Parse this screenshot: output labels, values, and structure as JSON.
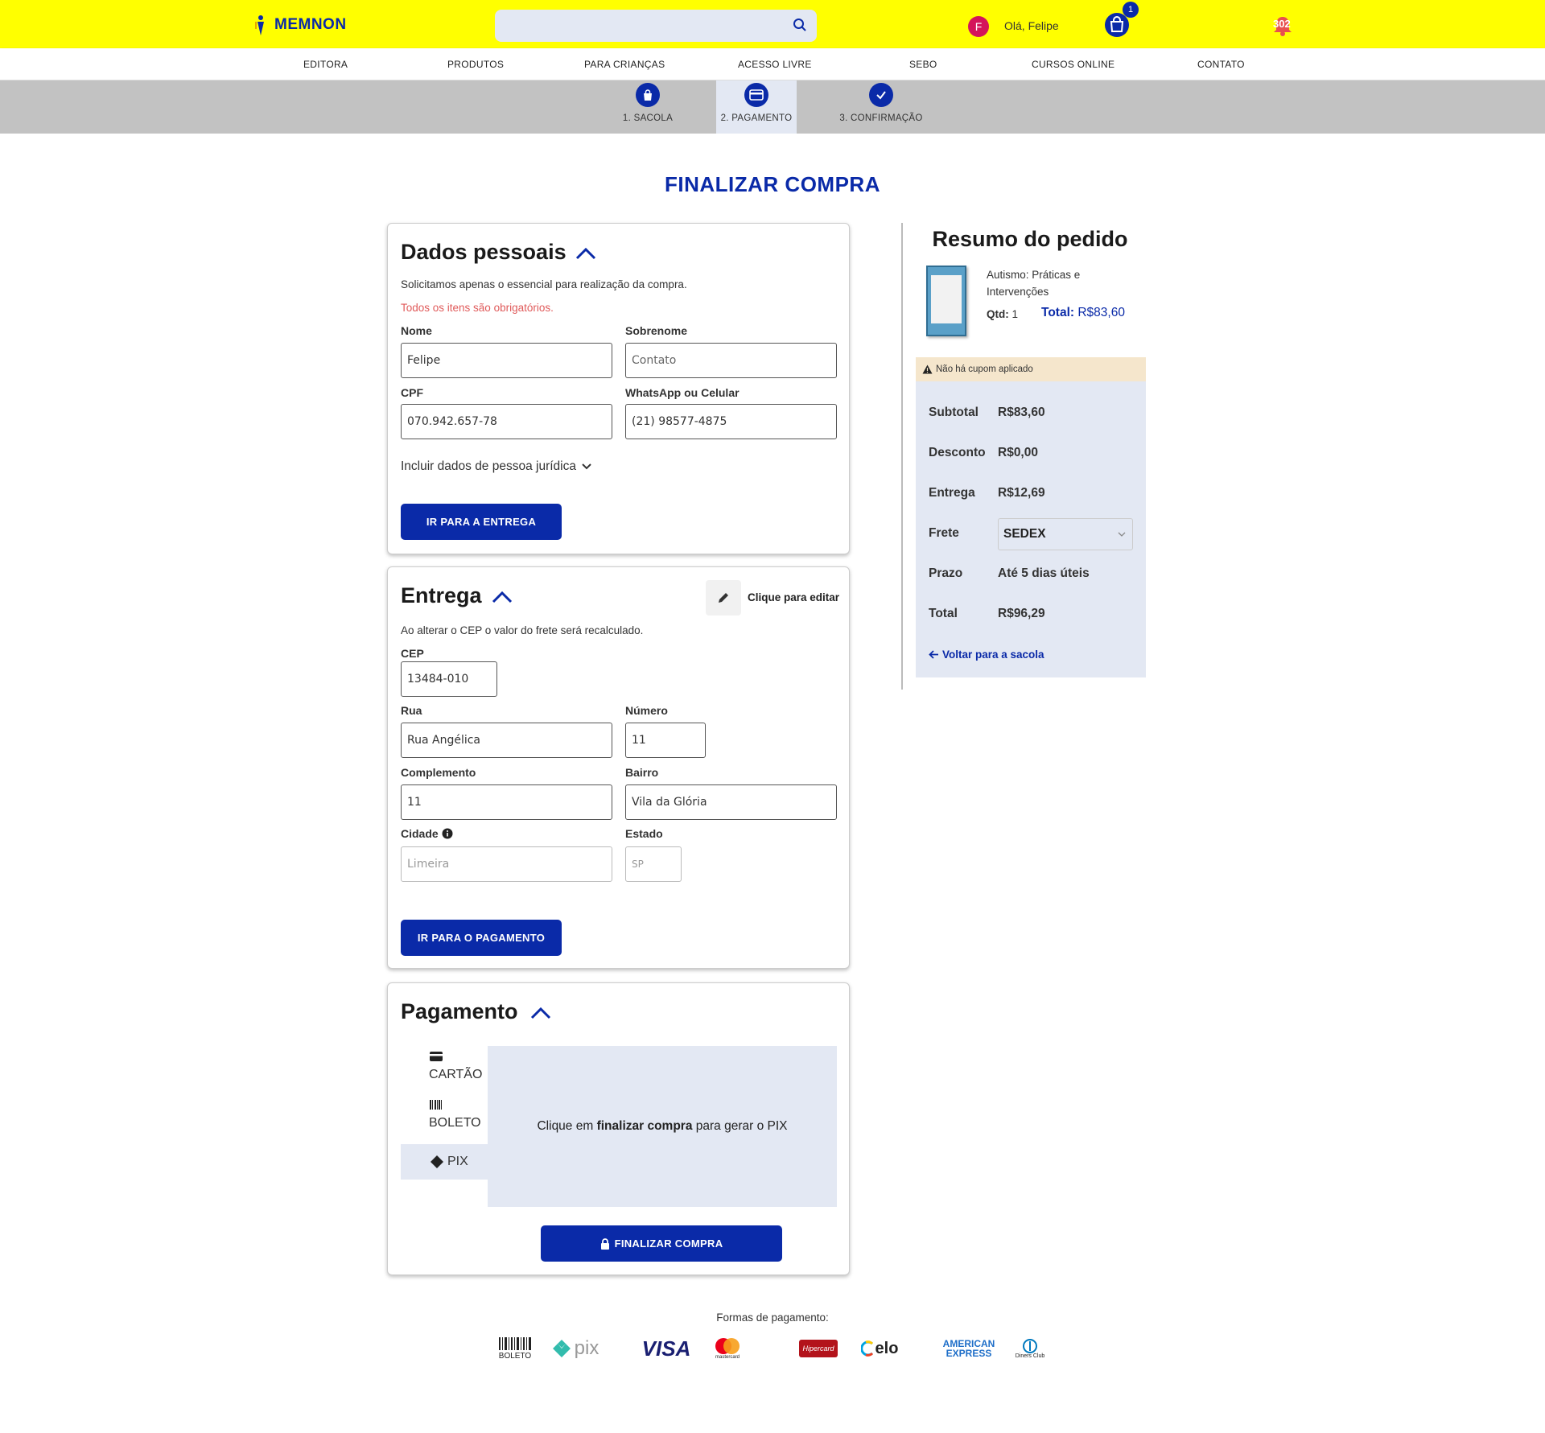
{
  "header": {
    "brand": "MEMNON",
    "search_placeholder": "",
    "user_initial": "F",
    "greeting": "Olá, Felipe",
    "cart_count": "1",
    "notification_count": "302"
  },
  "nav": {
    "items": [
      "EDITORA",
      "PRODUTOS",
      "PARA CRIANÇAS",
      "ACESSO LIVRE",
      "SEBO",
      "CURSOS ONLINE",
      "CONTATO"
    ]
  },
  "steps": [
    {
      "label": "1. SACOLA",
      "icon": "bag-icon"
    },
    {
      "label": "2. PAGAMENTO",
      "icon": "credit-card-icon"
    },
    {
      "label": "3. CONFIRMAÇÃO",
      "icon": "check-icon"
    }
  ],
  "page_title": "FINALIZAR COMPRA",
  "personal": {
    "title": "Dados pessoais",
    "subtitle": "Solicitamos apenas o essencial para realização da compra.",
    "required_note": "Todos os itens são obrigatórios.",
    "nome_label": "Nome",
    "nome_value": "Felipe",
    "sobrenome_label": "Sobrenome",
    "sobrenome_placeholder": "Contato",
    "cpf_label": "CPF",
    "cpf_value": "070.942.657-78",
    "phone_label": "WhatsApp ou Celular",
    "phone_value": "(21) 98577-4875",
    "pj_toggle": "Incluir dados de pessoa jurídica",
    "button": "IR PARA A ENTREGA"
  },
  "delivery": {
    "title": "Entrega",
    "edit_label": "Clique para editar",
    "note": "Ao alterar o CEP o valor do frete será recalculado.",
    "cep_label": "CEP",
    "cep_value": "13484-010",
    "rua_label": "Rua",
    "rua_value": "Rua Angélica",
    "numero_label": "Número",
    "numero_value": "11",
    "complemento_label": "Complemento",
    "complemento_value": "11",
    "bairro_label": "Bairro",
    "bairro_value": "Vila da Glória",
    "cidade_label": "Cidade",
    "cidade_placeholder": "Limeira",
    "estado_label": "Estado",
    "estado_placeholder": "SP",
    "button": "IR PARA O PAGAMENTO"
  },
  "payment": {
    "title": "Pagamento",
    "tabs": [
      "CARTÃO",
      "BOLETO",
      "PIX"
    ],
    "selected_tab": "PIX",
    "panel_prefix": "Clique em ",
    "panel_bold": "finalizar compra",
    "panel_suffix": " para gerar o PIX",
    "button": "FINALIZAR COMPRA"
  },
  "summary": {
    "title": "Resumo do pedido",
    "product_name": "Autismo: Práticas e Intervenções",
    "qty_label": "Qtd:",
    "qty_value": "1",
    "total_label": "Total:",
    "total_value": "R$83,60",
    "coupon_note": "Não há cupom aplicado",
    "subtotal_label": "Subtotal",
    "subtotal_value": "R$83,60",
    "discount_label": "Desconto",
    "discount_value": "R$0,00",
    "delivery_label": "Entrega",
    "delivery_value": "R$12,69",
    "shipping_label": "Frete",
    "shipping_value": "SEDEX",
    "deadline_label": "Prazo",
    "deadline_value": "Até 5 dias úteis",
    "grand_total_label": "Total",
    "grand_total_value": "R$96,29",
    "back_link": "Voltar para a sacola"
  },
  "footer": {
    "payment_methods_label": "Formas de pagamento:",
    "methods": [
      "BOLETO",
      "pix",
      "VISA",
      "mastercard",
      "Hipercard",
      "elo",
      "AMERICAN EXPRESS",
      "Diners Club"
    ]
  },
  "colors": {
    "brand_yellow": "#ffff00",
    "primary_blue": "#0a2aa8",
    "panel_bg": "#e3e8f3",
    "coupon_bg": "#f5e6cc",
    "required_red": "#e05a5a"
  }
}
